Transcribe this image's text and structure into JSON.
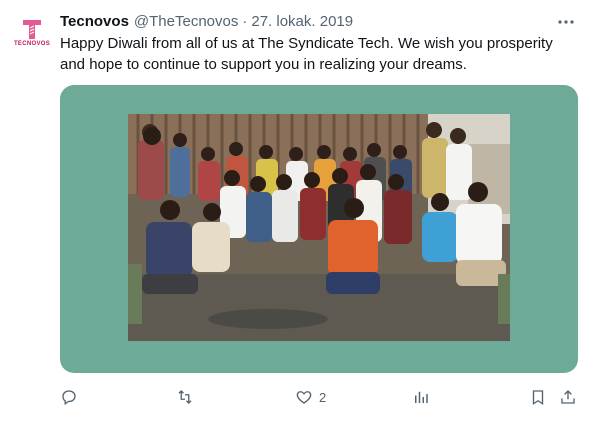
{
  "tweet": {
    "account": {
      "name": "Tecnovos",
      "handle": "@TheTecnovos",
      "logo_text": "TECNOVOS"
    },
    "date": "27. lokak. 2019",
    "text": "Happy Diwali from all of us at The Syndicate Tech. We wish you prosperity and hope to continue to support you in realizing your dreams.",
    "media": {
      "frame_color": "#6daa97"
    },
    "actions": {
      "reply_icon": "reply-icon",
      "retweet_icon": "retweet-icon",
      "like_icon": "heart-icon",
      "like_count": "2",
      "views_icon": "views-icon",
      "bookmark_icon": "bookmark-icon",
      "share_icon": "share-icon"
    }
  },
  "colors": {
    "text_primary": "#0f1419",
    "text_secondary": "#536471",
    "brand": "#c2185b"
  }
}
